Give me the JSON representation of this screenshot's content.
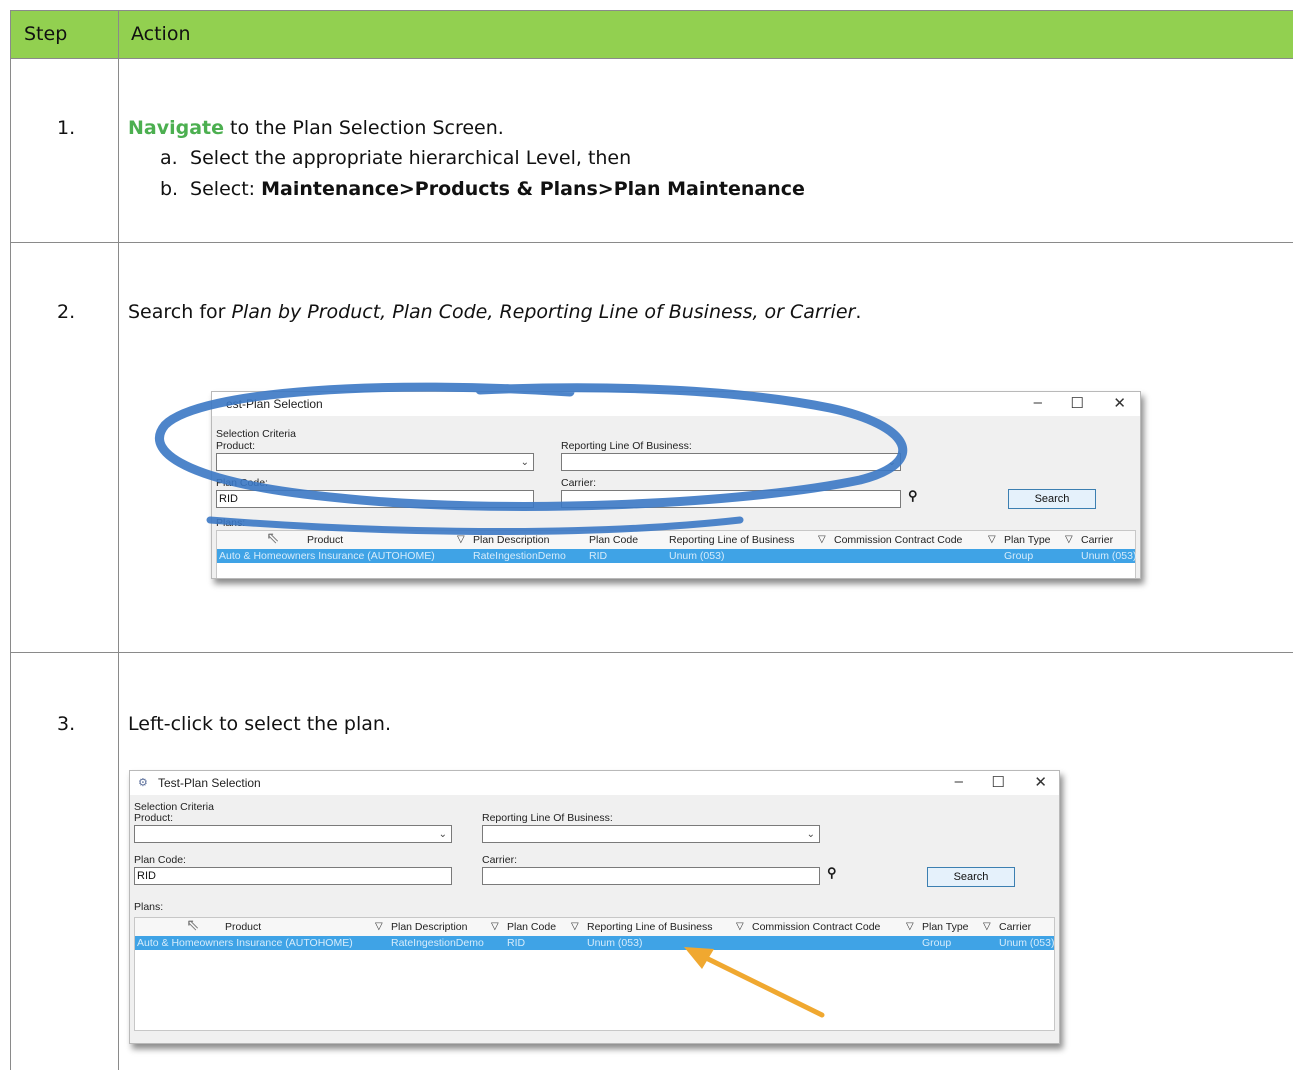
{
  "table": {
    "header": {
      "step": "Step",
      "action": "Action"
    },
    "rows": [
      {
        "step": "1.",
        "nav_word": "Navigate",
        "text": " to the Plan Selection Screen.",
        "subs": [
          {
            "label": "a.",
            "text": "Select the appropriate hierarchical Level, then"
          },
          {
            "label": "b.",
            "prefix": "Select: ",
            "bold": "Maintenance>Products & Plans>Plan Maintenance"
          }
        ]
      },
      {
        "step": "2.",
        "prefix": "Search for ",
        "italic": "Plan by Product, Plan Code, Reporting Line of Business, or Carrier",
        "suffix": "."
      },
      {
        "step": "3.",
        "text": "Left-click to select the plan."
      }
    ]
  },
  "window1": {
    "title": "est-Plan Selection",
    "minimize": "–",
    "maximize": "☐",
    "close": "✕",
    "selection_criteria": "Selection Criteria",
    "product_label": "Product:",
    "product_value": "",
    "rlob_label": "Reporting Line Of Business:",
    "rlob_value": "",
    "plan_code_label": "Plan Code:",
    "plan_code_value": "RID",
    "carrier_label": "Carrier:",
    "carrier_value": "",
    "search_button": "Search",
    "plans_label": "Plans:",
    "columns": [
      "Product",
      "Plan Description",
      "Plan Code",
      "Reporting Line of Business",
      "Commission Contract Code",
      "Plan Type",
      "Carrier"
    ],
    "row": [
      "Auto & Homeowners Insurance (AUTOHOME)",
      "RateIngestionDemo",
      "RID",
      "Unum (053)",
      "",
      "Group",
      "Unum (053)"
    ],
    "annotation_color": "#3b78c4"
  },
  "window2": {
    "title": "Test-Plan Selection",
    "minimize": "–",
    "maximize": "☐",
    "close": "✕",
    "selection_criteria": "Selection Criteria",
    "product_label": "Product:",
    "product_value": "",
    "rlob_label": "Reporting Line Of Business:",
    "rlob_value": "",
    "plan_code_label": "Plan Code:",
    "plan_code_value": "RID",
    "carrier_label": "Carrier:",
    "carrier_value": "",
    "search_button": "Search",
    "plans_label": "Plans:",
    "columns": [
      "Product",
      "Plan Description",
      "Plan Code",
      "Reporting Line of Business",
      "Commission Contract Code",
      "Plan Type",
      "Carrier"
    ],
    "row": [
      "Auto & Homeowners Insurance (AUTOHOME)",
      "RateIngestionDemo",
      "RID",
      "Unum (053)",
      "",
      "Group",
      "Unum (053)"
    ],
    "arrow_color": "#f0a830"
  },
  "colors": {
    "header_bg": "#92d050",
    "navigate": "#4caf50",
    "row_highlight": "#3fa3e6"
  }
}
